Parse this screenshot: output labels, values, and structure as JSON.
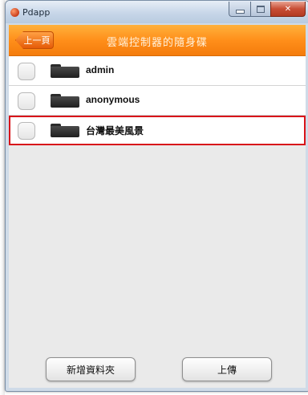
{
  "window": {
    "title": "Pdapp"
  },
  "header": {
    "back_label": "上一頁",
    "title": "雲端控制器的隨身碟"
  },
  "list": {
    "items": [
      {
        "label": "admin",
        "icon": "folder-icon",
        "checked": false,
        "selected": false
      },
      {
        "label": "anonymous",
        "icon": "folder-icon",
        "checked": false,
        "selected": false
      },
      {
        "label": "台灣最美風景",
        "icon": "folder-icon",
        "checked": false,
        "selected": true
      }
    ]
  },
  "footer": {
    "new_folder_label": "新增資料夾",
    "upload_label": "上傳"
  },
  "colors": {
    "header": "#ff8f1a",
    "selection_outline": "#d8141a",
    "background": "#eaeaea"
  }
}
